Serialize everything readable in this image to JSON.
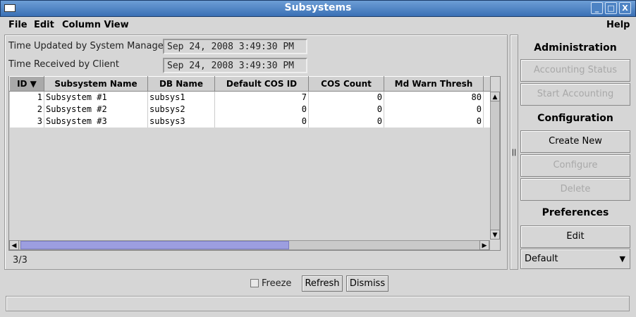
{
  "window": {
    "title": "Subsystems",
    "buttons": {
      "minimize": "_",
      "maximize": "□",
      "close": "X"
    }
  },
  "menu": {
    "file": "File",
    "edit": "Edit",
    "column_view": "Column View",
    "help": "Help"
  },
  "times": {
    "updated_label": "Time Updated by System Manager",
    "updated_value": "Sep 24, 2008 3:49:30 PM",
    "received_label": "Time Received by Client",
    "received_value": "Sep 24, 2008 3:49:30 PM"
  },
  "table": {
    "columns": [
      "ID ▼",
      "Subsystem Name",
      "DB Name",
      "Default COS ID",
      "COS Count",
      "Md Warn Thresh"
    ],
    "rows": [
      [
        "1",
        "Subsystem #1",
        "subsys1",
        "7",
        "0",
        "80"
      ],
      [
        "2",
        "Subsystem #2",
        "subsys2",
        "0",
        "0",
        "0"
      ],
      [
        "3",
        "Subsystem #3",
        "subsys3",
        "0",
        "0",
        "0"
      ]
    ],
    "count": "3/3"
  },
  "sidebar": {
    "administration": "Administration",
    "accounting_status": "Accounting Status",
    "start_accounting": "Start Accounting",
    "configuration": "Configuration",
    "create_new": "Create New",
    "configure": "Configure",
    "delete": "Delete",
    "preferences": "Preferences",
    "edit": "Edit",
    "preference_select": "Default"
  },
  "footer": {
    "freeze": "Freeze",
    "refresh": "Refresh",
    "dismiss": "Dismiss"
  }
}
